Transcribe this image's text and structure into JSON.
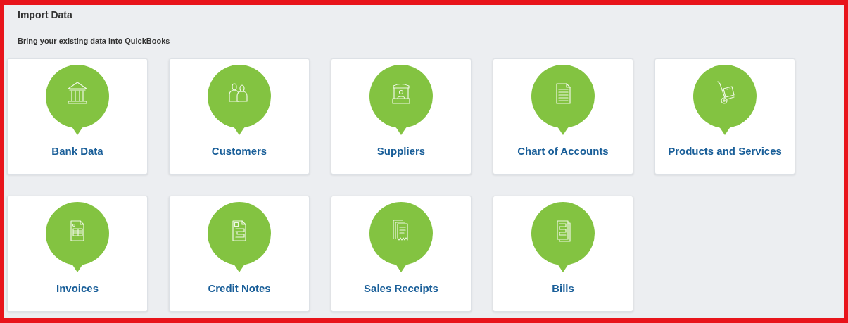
{
  "title": "Import Data",
  "subtitle": "Bring your existing data into QuickBooks",
  "rows": [
    [
      {
        "kind": "bank",
        "label": "Bank Data"
      },
      {
        "kind": "people",
        "label": "Customers"
      },
      {
        "kind": "kiosk",
        "label": "Suppliers"
      },
      {
        "kind": "document",
        "label": "Chart of Accounts"
      },
      {
        "kind": "trolley",
        "label": "Products and Services"
      }
    ],
    [
      {
        "kind": "invoice",
        "label": "Invoices"
      },
      {
        "kind": "credit",
        "label": "Credit Notes"
      },
      {
        "kind": "receipt",
        "label": "Sales Receipts"
      },
      {
        "kind": "bills",
        "label": "Bills"
      }
    ]
  ]
}
